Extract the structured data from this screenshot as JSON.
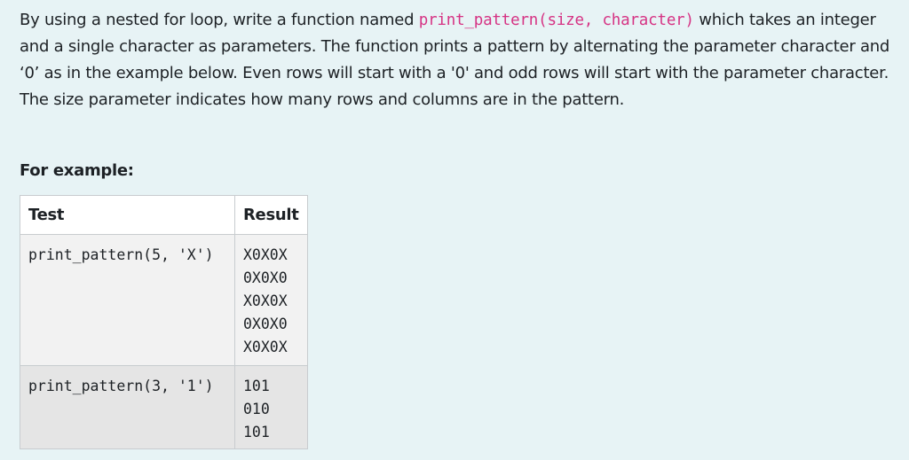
{
  "question": {
    "part1": "By using a nested for loop, write a function named ",
    "code_signature": "print_pattern(size, character)",
    "part2": " which takes an integer and a single character as parameters. The function prints a pattern by alternating the parameter character and ‘0’ as in the example below. Even rows will start with a '0' and odd rows will start with the parameter character. The size parameter indicates how many rows and columns are in the pattern."
  },
  "example_heading": "For example:",
  "table": {
    "headers": {
      "test": "Test",
      "result": "Result"
    },
    "rows": [
      {
        "test": "print_pattern(5, 'X')",
        "result": "X0X0X\n0X0X0\nX0X0X\n0X0X0\nX0X0X"
      },
      {
        "test": "print_pattern(3, '1')",
        "result": "101\n010\n101"
      }
    ]
  },
  "colors": {
    "page_background": "#e7f3f5",
    "inline_code": "#d63384",
    "row_odd_background": "#f2f2f2",
    "row_even_background": "#e5e5e5"
  }
}
